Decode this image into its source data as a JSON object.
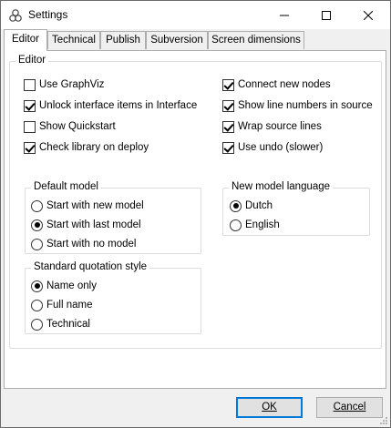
{
  "window": {
    "title": "Settings",
    "icon": "settings-app-icon"
  },
  "tabs": [
    {
      "label": "Editor",
      "active": true
    },
    {
      "label": "Technical",
      "active": false
    },
    {
      "label": "Publish",
      "active": false
    },
    {
      "label": "Subversion",
      "active": false
    },
    {
      "label": "Screen dimensions",
      "active": false
    }
  ],
  "editor_group": {
    "legend": "Editor",
    "left_options": [
      {
        "label": "Use GraphViz",
        "checked": false
      },
      {
        "label": "Unlock interface items in Interface",
        "checked": true
      },
      {
        "label": "Show Quickstart",
        "checked": false
      },
      {
        "label": "Check library on deploy",
        "checked": true
      }
    ],
    "right_options": [
      {
        "label": "Connect new nodes",
        "checked": true
      },
      {
        "label": "Show line numbers in source",
        "checked": true
      },
      {
        "label": "Wrap source lines",
        "checked": true
      },
      {
        "label": "Use undo (slower)",
        "checked": true
      }
    ]
  },
  "default_model": {
    "legend": "Default model",
    "options": [
      {
        "label": "Start with new model",
        "selected": false
      },
      {
        "label": "Start with last model",
        "selected": true
      },
      {
        "label": "Start with no model",
        "selected": false
      }
    ]
  },
  "new_model_language": {
    "legend": "New model language",
    "options": [
      {
        "label": "Dutch",
        "selected": true
      },
      {
        "label": "English",
        "selected": false
      }
    ]
  },
  "quotation_style": {
    "legend": "Standard quotation style",
    "options": [
      {
        "label": "Name only",
        "selected": true
      },
      {
        "label": "Full name",
        "selected": false
      },
      {
        "label": "Technical",
        "selected": false
      }
    ]
  },
  "buttons": {
    "ok": "OK",
    "cancel": "Cancel"
  }
}
